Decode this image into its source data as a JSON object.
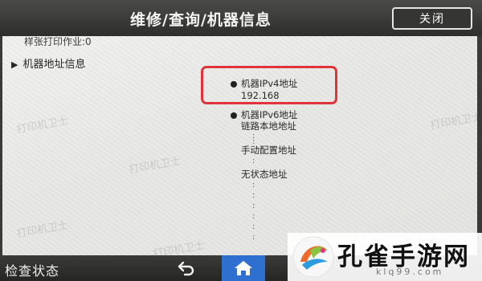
{
  "header": {
    "title": "维修/查询/机器信息",
    "close_label": "关闭"
  },
  "content": {
    "prev_line": "样张打印作业:0",
    "section_title": "机器地址信息",
    "ipv4": {
      "label": "机器IPv4地址",
      "value": "192.168"
    },
    "ipv6": {
      "label": "机器IPv6地址",
      "link_local_label": "链路本地地址",
      "manual_label": "手动配置地址",
      "stateless_label": "无状态地址",
      "dots": ":"
    }
  },
  "watermark": "打印机卫士",
  "footer": {
    "status_label": "检查状态",
    "back_icon": "back-arrow-icon",
    "home_icon": "home-icon"
  },
  "logo": {
    "text": "孔雀手游网",
    "url": "klq99.com"
  },
  "colors": {
    "highlight": "#e0343a",
    "home_active": "#2f6fd0",
    "bar": "#2e2e2c"
  }
}
